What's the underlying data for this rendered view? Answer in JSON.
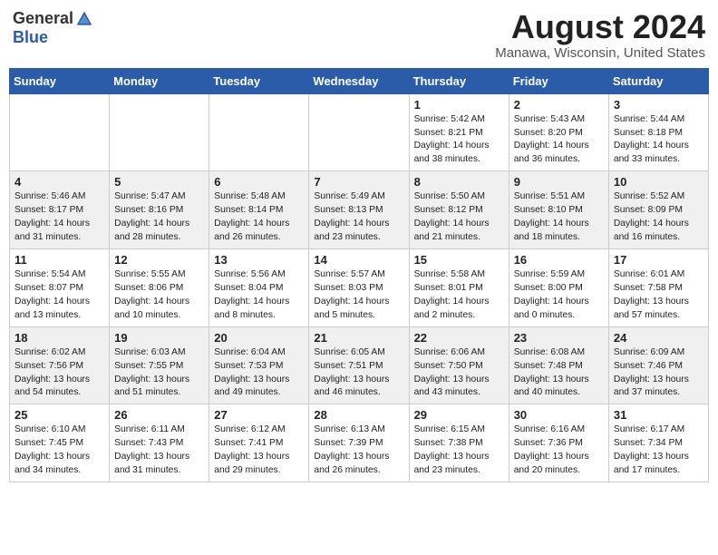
{
  "header": {
    "logo_general": "General",
    "logo_blue": "Blue",
    "month_year": "August 2024",
    "location": "Manawa, Wisconsin, United States"
  },
  "days_of_week": [
    "Sunday",
    "Monday",
    "Tuesday",
    "Wednesday",
    "Thursday",
    "Friday",
    "Saturday"
  ],
  "weeks": [
    [
      {
        "day": "",
        "detail": ""
      },
      {
        "day": "",
        "detail": ""
      },
      {
        "day": "",
        "detail": ""
      },
      {
        "day": "",
        "detail": ""
      },
      {
        "day": "1",
        "detail": "Sunrise: 5:42 AM\nSunset: 8:21 PM\nDaylight: 14 hours\nand 38 minutes."
      },
      {
        "day": "2",
        "detail": "Sunrise: 5:43 AM\nSunset: 8:20 PM\nDaylight: 14 hours\nand 36 minutes."
      },
      {
        "day": "3",
        "detail": "Sunrise: 5:44 AM\nSunset: 8:18 PM\nDaylight: 14 hours\nand 33 minutes."
      }
    ],
    [
      {
        "day": "4",
        "detail": "Sunrise: 5:46 AM\nSunset: 8:17 PM\nDaylight: 14 hours\nand 31 minutes."
      },
      {
        "day": "5",
        "detail": "Sunrise: 5:47 AM\nSunset: 8:16 PM\nDaylight: 14 hours\nand 28 minutes."
      },
      {
        "day": "6",
        "detail": "Sunrise: 5:48 AM\nSunset: 8:14 PM\nDaylight: 14 hours\nand 26 minutes."
      },
      {
        "day": "7",
        "detail": "Sunrise: 5:49 AM\nSunset: 8:13 PM\nDaylight: 14 hours\nand 23 minutes."
      },
      {
        "day": "8",
        "detail": "Sunrise: 5:50 AM\nSunset: 8:12 PM\nDaylight: 14 hours\nand 21 minutes."
      },
      {
        "day": "9",
        "detail": "Sunrise: 5:51 AM\nSunset: 8:10 PM\nDaylight: 14 hours\nand 18 minutes."
      },
      {
        "day": "10",
        "detail": "Sunrise: 5:52 AM\nSunset: 8:09 PM\nDaylight: 14 hours\nand 16 minutes."
      }
    ],
    [
      {
        "day": "11",
        "detail": "Sunrise: 5:54 AM\nSunset: 8:07 PM\nDaylight: 14 hours\nand 13 minutes."
      },
      {
        "day": "12",
        "detail": "Sunrise: 5:55 AM\nSunset: 8:06 PM\nDaylight: 14 hours\nand 10 minutes."
      },
      {
        "day": "13",
        "detail": "Sunrise: 5:56 AM\nSunset: 8:04 PM\nDaylight: 14 hours\nand 8 minutes."
      },
      {
        "day": "14",
        "detail": "Sunrise: 5:57 AM\nSunset: 8:03 PM\nDaylight: 14 hours\nand 5 minutes."
      },
      {
        "day": "15",
        "detail": "Sunrise: 5:58 AM\nSunset: 8:01 PM\nDaylight: 14 hours\nand 2 minutes."
      },
      {
        "day": "16",
        "detail": "Sunrise: 5:59 AM\nSunset: 8:00 PM\nDaylight: 14 hours\nand 0 minutes."
      },
      {
        "day": "17",
        "detail": "Sunrise: 6:01 AM\nSunset: 7:58 PM\nDaylight: 13 hours\nand 57 minutes."
      }
    ],
    [
      {
        "day": "18",
        "detail": "Sunrise: 6:02 AM\nSunset: 7:56 PM\nDaylight: 13 hours\nand 54 minutes."
      },
      {
        "day": "19",
        "detail": "Sunrise: 6:03 AM\nSunset: 7:55 PM\nDaylight: 13 hours\nand 51 minutes."
      },
      {
        "day": "20",
        "detail": "Sunrise: 6:04 AM\nSunset: 7:53 PM\nDaylight: 13 hours\nand 49 minutes."
      },
      {
        "day": "21",
        "detail": "Sunrise: 6:05 AM\nSunset: 7:51 PM\nDaylight: 13 hours\nand 46 minutes."
      },
      {
        "day": "22",
        "detail": "Sunrise: 6:06 AM\nSunset: 7:50 PM\nDaylight: 13 hours\nand 43 minutes."
      },
      {
        "day": "23",
        "detail": "Sunrise: 6:08 AM\nSunset: 7:48 PM\nDaylight: 13 hours\nand 40 minutes."
      },
      {
        "day": "24",
        "detail": "Sunrise: 6:09 AM\nSunset: 7:46 PM\nDaylight: 13 hours\nand 37 minutes."
      }
    ],
    [
      {
        "day": "25",
        "detail": "Sunrise: 6:10 AM\nSunset: 7:45 PM\nDaylight: 13 hours\nand 34 minutes."
      },
      {
        "day": "26",
        "detail": "Sunrise: 6:11 AM\nSunset: 7:43 PM\nDaylight: 13 hours\nand 31 minutes."
      },
      {
        "day": "27",
        "detail": "Sunrise: 6:12 AM\nSunset: 7:41 PM\nDaylight: 13 hours\nand 29 minutes."
      },
      {
        "day": "28",
        "detail": "Sunrise: 6:13 AM\nSunset: 7:39 PM\nDaylight: 13 hours\nand 26 minutes."
      },
      {
        "day": "29",
        "detail": "Sunrise: 6:15 AM\nSunset: 7:38 PM\nDaylight: 13 hours\nand 23 minutes."
      },
      {
        "day": "30",
        "detail": "Sunrise: 6:16 AM\nSunset: 7:36 PM\nDaylight: 13 hours\nand 20 minutes."
      },
      {
        "day": "31",
        "detail": "Sunrise: 6:17 AM\nSunset: 7:34 PM\nDaylight: 13 hours\nand 17 minutes."
      }
    ]
  ]
}
